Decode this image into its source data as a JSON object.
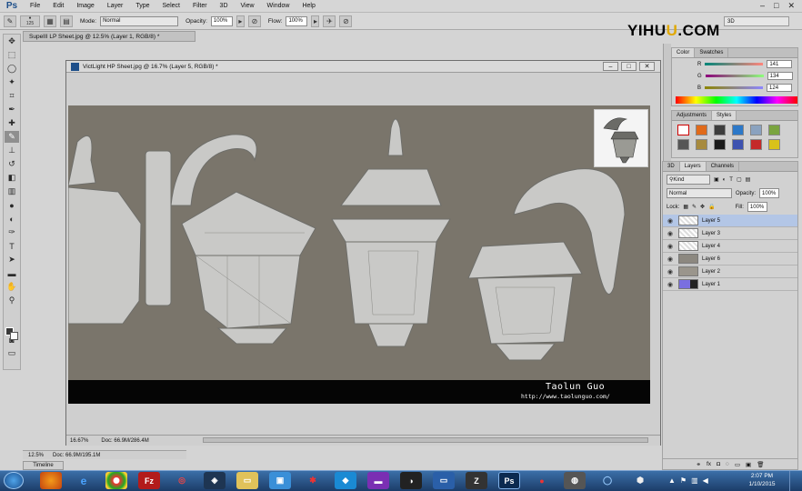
{
  "app": {
    "logo": "Ps"
  },
  "menu": [
    "File",
    "Edit",
    "Image",
    "Layer",
    "Type",
    "Select",
    "Filter",
    "3D",
    "View",
    "Window",
    "Help"
  ],
  "window_controls": [
    "–",
    "□",
    "✕"
  ],
  "options": {
    "brush_size": "125",
    "mode_label": "Mode:",
    "mode_value": "Normal",
    "opacity_label": "Opacity:",
    "opacity_value": "100%",
    "flow_label": "Flow:",
    "flow_value": "100%",
    "workspace": "3D"
  },
  "watermark": {
    "main": "YIHU",
    "accent": "U",
    "suffix": ".COM"
  },
  "doc_back": {
    "tab": "SupeIII LP Sheet.jpg @ 12.5% (Layer 1, RGB/8) *",
    "zoom": "12.5%",
    "doc_size": "Doc: 66.9M/195.1M"
  },
  "doc_main": {
    "title": "VictLight HP Sheet.jpg @ 16.7% (Layer 5, RGB/8) *",
    "zoom": "16.67%",
    "doc_size": "Doc: 66.9M/286.4M",
    "author": "Taolun Guo",
    "url": "http://www.taolunguo.com/"
  },
  "timeline_label": "Timeline",
  "color_panel": {
    "tabs": [
      "Color",
      "Swatches"
    ],
    "rows": [
      {
        "label": "R",
        "value": "141"
      },
      {
        "label": "G",
        "value": "134"
      },
      {
        "label": "B",
        "value": "124"
      }
    ]
  },
  "styles_panel": {
    "tabs": [
      "Adjustments",
      "Styles"
    ]
  },
  "layers_panel": {
    "tabs": [
      "3D",
      "Layers",
      "Channels"
    ],
    "kind": "Kind",
    "blend": "Normal",
    "opacity_label": "Opacity:",
    "opacity": "100%",
    "lock_label": "Lock:",
    "fill_label": "Fill:",
    "fill": "100%",
    "layers": [
      "Layer 5",
      "Layer 3",
      "Layer 4",
      "Layer 6",
      "Layer 2",
      "Layer 1"
    ],
    "footer": [
      "⚭",
      "fx",
      "◘",
      "◌",
      "▭",
      "▣",
      "🗑"
    ]
  },
  "clock": {
    "time": "2:07 PM",
    "date": "1/10/2015"
  },
  "colors": {
    "canvas": "#7a756b",
    "selected_layer": "#b3c6e6",
    "taskbar": "#1c3d69"
  }
}
